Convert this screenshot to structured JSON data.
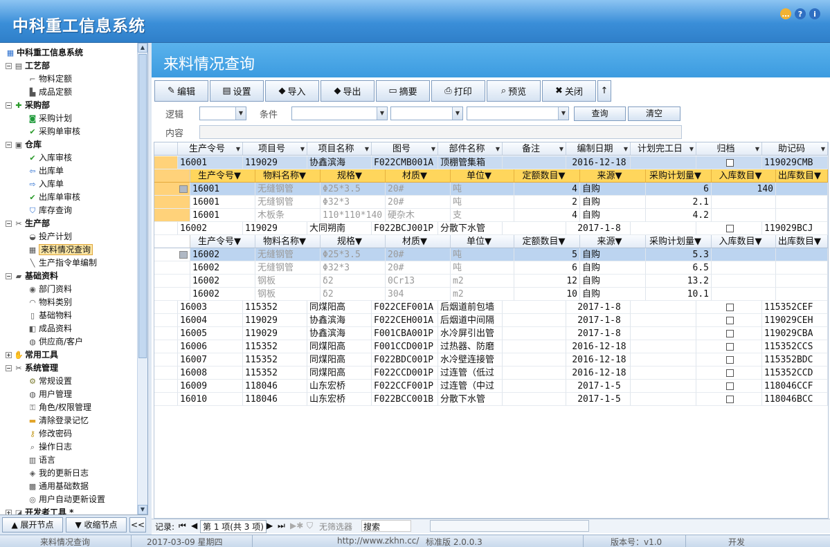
{
  "app": {
    "title": "中科重工信息系统"
  },
  "sidebar": {
    "root": "中科重工信息系统",
    "tree": [
      {
        "label": "工艺部",
        "level": 1,
        "icon": "document-icon",
        "exp": "−"
      },
      {
        "label": "物料定额",
        "level": 2,
        "icon": "ruler-icon"
      },
      {
        "label": "成品定额",
        "level": 2,
        "icon": "chart-icon"
      },
      {
        "label": "采购部",
        "level": 1,
        "icon": "plus-icon",
        "exp": "−"
      },
      {
        "label": "采购计划",
        "level": 2,
        "icon": "cylinder-icon"
      },
      {
        "label": "采购单审核",
        "level": 2,
        "icon": "check-icon"
      },
      {
        "label": "仓库",
        "level": 1,
        "icon": "box-icon",
        "exp": "−"
      },
      {
        "label": "入库审核",
        "level": 2,
        "icon": "check-icon"
      },
      {
        "label": "出库单",
        "level": 2,
        "icon": "arrow-left-icon"
      },
      {
        "label": "入库单",
        "level": 2,
        "icon": "arrow-right-icon"
      },
      {
        "label": "出库单审核",
        "level": 2,
        "icon": "check-icon"
      },
      {
        "label": "库存查询",
        "level": 2,
        "icon": "filter-icon"
      },
      {
        "label": "生产部",
        "level": 1,
        "icon": "tools-icon",
        "exp": "−"
      },
      {
        "label": "投产计划",
        "level": 2,
        "icon": "plan-icon"
      },
      {
        "label": "来料情况查询",
        "level": 2,
        "icon": "calendar-icon",
        "selected": true
      },
      {
        "label": "生产指令单编制",
        "level": 2,
        "icon": "pen-icon"
      },
      {
        "label": "基础资料",
        "level": 1,
        "icon": "base-icon",
        "exp": "−"
      },
      {
        "label": "部门资料",
        "level": 2,
        "icon": "users-icon"
      },
      {
        "label": "物料类别",
        "level": 2,
        "icon": "arc-icon"
      },
      {
        "label": "基础物料",
        "level": 2,
        "icon": "doc-icon"
      },
      {
        "label": "成品资料",
        "level": 2,
        "icon": "book-icon"
      },
      {
        "label": "供应商/客户",
        "level": 2,
        "icon": "user-icon"
      },
      {
        "label": "常用工具",
        "level": 1,
        "icon": "hand-icon",
        "exp": "+"
      },
      {
        "label": "系统管理",
        "level": 1,
        "icon": "tools-icon",
        "exp": "−"
      },
      {
        "label": "常规设置",
        "level": 2,
        "icon": "gear-icon"
      },
      {
        "label": "用户管理",
        "level": 2,
        "icon": "user-icon"
      },
      {
        "label": "角色/权限管理",
        "level": 2,
        "icon": "lock-icon"
      },
      {
        "label": "清除登录记忆",
        "level": 2,
        "icon": "folder-icon"
      },
      {
        "label": "修改密码",
        "level": 2,
        "icon": "key-icon"
      },
      {
        "label": "操作日志",
        "level": 2,
        "icon": "search-icon"
      },
      {
        "label": "语言",
        "level": 2,
        "icon": "language-icon"
      },
      {
        "label": "我的更新日志",
        "level": 2,
        "icon": "log-icon"
      },
      {
        "label": "通用基础数据",
        "level": 2,
        "icon": "data-icon"
      },
      {
        "label": "用户自动更新设置",
        "level": 2,
        "icon": "update-icon"
      },
      {
        "label": "开发者工具 *",
        "level": 1,
        "icon": "dev-icon",
        "exp": "+"
      }
    ],
    "expand_btn": "展开节点",
    "collapse_btn": "收缩节点",
    "toggle_btn": "<<"
  },
  "page": {
    "title": "来料情况查询"
  },
  "toolbar": [
    {
      "label": "编辑",
      "icon": "edit-icon",
      "glyph": "✎",
      "w": 78
    },
    {
      "label": "设置",
      "icon": "settings-icon",
      "glyph": "▤",
      "w": 78
    },
    {
      "label": "导入",
      "icon": "import-icon",
      "glyph": "◆",
      "w": 78
    },
    {
      "label": "导出",
      "icon": "export-icon",
      "glyph": "◆",
      "w": 78
    },
    {
      "label": "摘要",
      "icon": "summary-icon",
      "glyph": "▭",
      "w": 78
    },
    {
      "label": "打印",
      "icon": "print-icon",
      "glyph": "⎙",
      "w": 78
    },
    {
      "label": "预览",
      "icon": "preview-icon",
      "glyph": "⌕",
      "w": 78
    },
    {
      "label": "关闭",
      "icon": "close-icon",
      "glyph": "✖",
      "w": 78
    },
    {
      "label": "↑",
      "icon": "up-arrow-icon",
      "glyph": "",
      "w": 20
    }
  ],
  "filter": {
    "logic_label": "逻辑",
    "cond_label": "条件",
    "content_label": "内容",
    "query_btn": "查询",
    "clear_btn": "清空"
  },
  "grid": {
    "columns": [
      "生产令号",
      "项目号",
      "项目名称",
      "图号",
      "部件名称",
      "备注",
      "编制日期",
      "计划完工日",
      "归档",
      "助记码"
    ],
    "sub_columns": [
      "生产令号",
      "物料名称",
      "规格",
      "材质",
      "单位",
      "定额数目",
      "来源",
      "采购计划量",
      "入库数目",
      "出库数目"
    ],
    "rows": [
      {
        "exp": "−",
        "cells": [
          "16001",
          "119029",
          "协鑫滨海",
          "F022CMB001A",
          "顶棚管集箱",
          "",
          "2016-12-18",
          "",
          "",
          "119029CMB"
        ],
        "sub": [
          [
            "16001",
            "无缝钢管",
            "Φ25*3.5",
            "20#",
            "吨",
            "4",
            "自购",
            "6",
            "140",
            ""
          ],
          [
            "16001",
            "无缝钢管",
            "Φ32*3",
            "20#",
            "吨",
            "2",
            "自购",
            "2.1",
            "",
            ""
          ],
          [
            "16001",
            "木板条",
            "110*110*140",
            "硬杂木",
            "支",
            "4",
            "自购",
            "4.2",
            "",
            ""
          ]
        ]
      },
      {
        "exp": "−",
        "cells": [
          "16002",
          "119029",
          "大同朔南",
          "F022BCJ001P",
          "分散下水管",
          "",
          "2017-1-8",
          "",
          "",
          "119029BCJ"
        ],
        "sub": [
          [
            "16002",
            "无缝钢管",
            "Φ25*3.5",
            "20#",
            "吨",
            "5",
            "自购",
            "5.3",
            "",
            ""
          ],
          [
            "16002",
            "无缝钢管",
            "Φ32*3",
            "20#",
            "吨",
            "6",
            "自购",
            "6.5",
            "",
            ""
          ],
          [
            "16002",
            "钢板",
            "δ2",
            "0Cr13",
            "m2",
            "12",
            "自购",
            "13.2",
            "",
            ""
          ],
          [
            "16002",
            "钢板",
            "δ2",
            "304",
            "m2",
            "10",
            "自购",
            "10.1",
            "",
            ""
          ]
        ]
      },
      {
        "exp": "+",
        "cells": [
          "16003",
          "115352",
          "同煤阳高",
          "F022CEF001A",
          "后烟道前包墙",
          "",
          "2017-1-8",
          "",
          "",
          "115352CEF"
        ]
      },
      {
        "exp": "+",
        "cells": [
          "16004",
          "119029",
          "协鑫滨海",
          "F022CEH001A",
          "后烟道中间隔",
          "",
          "2017-1-8",
          "",
          "",
          "119029CEH"
        ]
      },
      {
        "exp": "+",
        "cells": [
          "16005",
          "119029",
          "协鑫滨海",
          "F001CBA001P",
          "水冷屏引出管",
          "",
          "2017-1-8",
          "",
          "",
          "119029CBA"
        ]
      },
      {
        "exp": "+",
        "cells": [
          "16006",
          "115352",
          "同煤阳高",
          "F001CCD001P",
          "过热器、防磨",
          "",
          "2016-12-18",
          "",
          "",
          "115352CCS"
        ]
      },
      {
        "exp": "+",
        "cells": [
          "16007",
          "115352",
          "同煤阳高",
          "F022BDC001P",
          "水冷壁连接管",
          "",
          "2016-12-18",
          "",
          "",
          "115352BDC"
        ]
      },
      {
        "exp": "+",
        "cells": [
          "16008",
          "115352",
          "同煤阳高",
          "F022CCD001P",
          "过连管（低过",
          "",
          "2016-12-18",
          "",
          "",
          "115352CCD"
        ]
      },
      {
        "exp": "+",
        "cells": [
          "16009",
          "118046",
          "山东宏桥",
          "F022CCF001P",
          "过连管（中过",
          "",
          "2017-1-5",
          "",
          "",
          "118046CCF"
        ]
      },
      {
        "exp": "+",
        "cells": [
          "16010",
          "118046",
          "山东宏桥",
          "F022BCC001B",
          "分散下水管",
          "",
          "2017-1-5",
          "",
          "",
          "118046BCC"
        ]
      }
    ]
  },
  "nav": {
    "records_label": "记录:",
    "page_info": "第 1 项(共 3 项)",
    "no_filter": "无筛选器",
    "search": "搜索"
  },
  "status": {
    "form": "来料情况查询",
    "date": "2017-03-09 星期四",
    "url": "http://www.zkhn.cc/",
    "edition": "标准版 2.0.0.3",
    "version": "版本号：v1.0",
    "developer": "开发"
  },
  "colors": {
    "header_blue": "#3c9be0",
    "sub_header": "#ffd65c",
    "selected_row": "#bcd4f0"
  }
}
